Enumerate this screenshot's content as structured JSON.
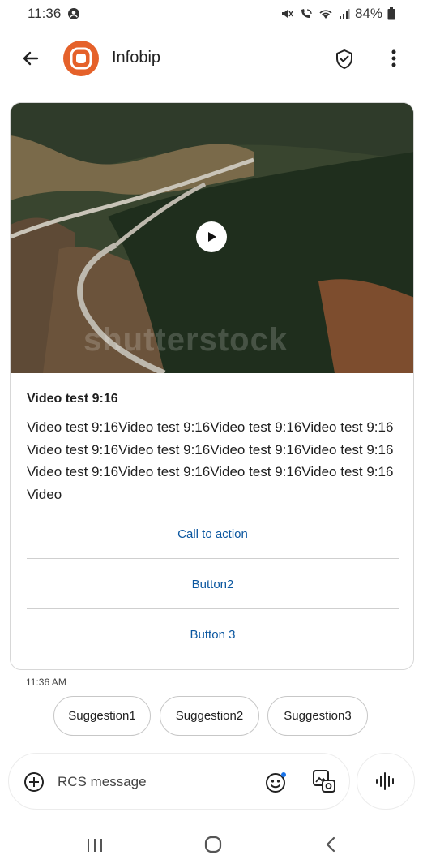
{
  "status_bar": {
    "time": "11:36",
    "battery": "84%",
    "icons": [
      "account-circle-icon",
      "mute-icon",
      "wifi-call-icon",
      "wifi-icon",
      "signal-icon",
      "battery-icon"
    ]
  },
  "header": {
    "title": "Infobip",
    "icons": [
      "back-arrow-icon",
      "shield-check-icon",
      "more-vert-icon"
    ],
    "avatar_color": "#e5612a"
  },
  "card": {
    "media_watermark": "shutterstock",
    "media_icon": "play-icon",
    "title": "Video test 9:16",
    "body": "Video test 9:16Video test 9:16Video test 9:16Video test 9:16Video test 9:16Video test 9:16Video test 9:16Video test 9:16Video test 9:16Video test 9:16Video test 9:16Video test 9:16Video",
    "actions": [
      "Call to action",
      "Button2",
      "Button 3"
    ],
    "action_color": "#0b57a0"
  },
  "timestamp": "11:36 AM",
  "suggestions": [
    "Suggestion1",
    "Suggestion2",
    "Suggestion3"
  ],
  "composer": {
    "placeholder": "RCS message",
    "icons": [
      "add-circle-icon",
      "emoji-icon",
      "gallery-icon",
      "voice-icon"
    ]
  },
  "nav_bar": {
    "icons": [
      "recents-icon",
      "home-icon",
      "nav-back-icon"
    ]
  }
}
